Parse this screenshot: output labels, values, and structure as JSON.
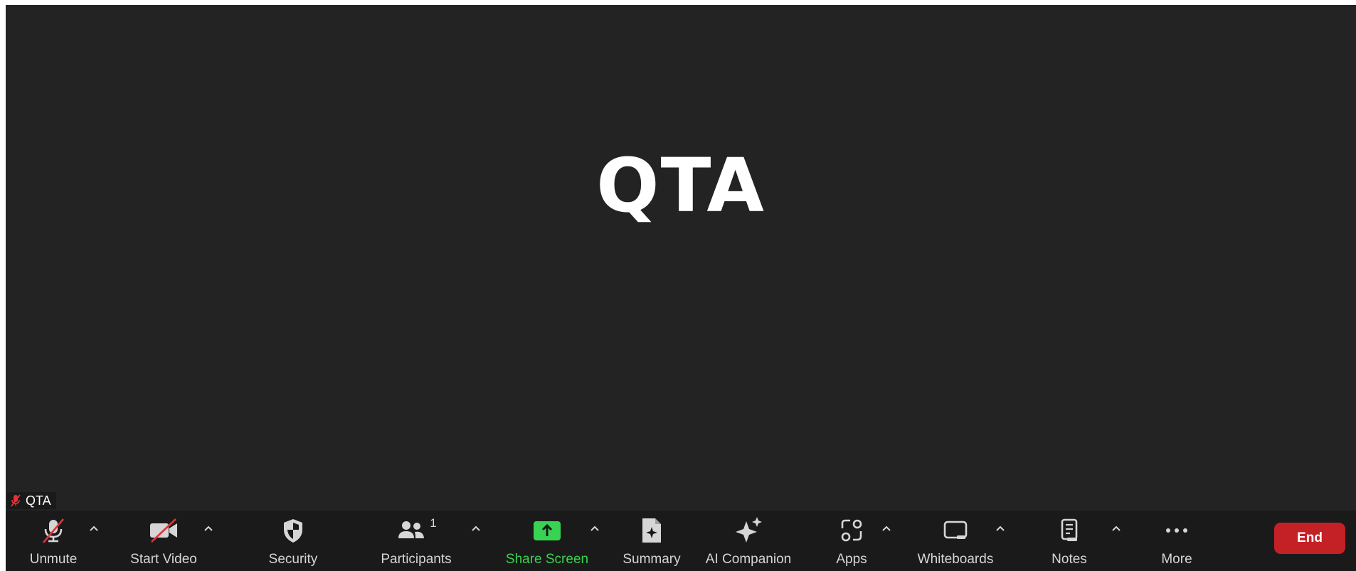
{
  "meeting": {
    "participant_display_name": "QTA",
    "name_tag": "QTA"
  },
  "toolbar": {
    "unmute_label": "Unmute",
    "start_video_label": "Start Video",
    "security_label": "Security",
    "participants_label": "Participants",
    "participants_count": "1",
    "share_screen_label": "Share Screen",
    "summary_label": "Summary",
    "ai_companion_label": "AI Companion",
    "apps_label": "Apps",
    "whiteboards_label": "Whiteboards",
    "notes_label": "Notes",
    "more_label": "More",
    "end_label": "End"
  },
  "colors": {
    "background": "#232323",
    "toolbar": "#1a1a1a",
    "share_accent": "#39d353",
    "end_button": "#c42127",
    "muted_red": "#e0333b"
  },
  "icons": [
    "microphone-muted-icon",
    "video-camera-off-icon",
    "shield-icon",
    "people-icon",
    "share-arrow-icon",
    "summary-doc-icon",
    "sparkle-icon",
    "apps-icon",
    "whiteboard-icon",
    "notes-icon",
    "more-dots-icon",
    "caret-up-icon"
  ]
}
